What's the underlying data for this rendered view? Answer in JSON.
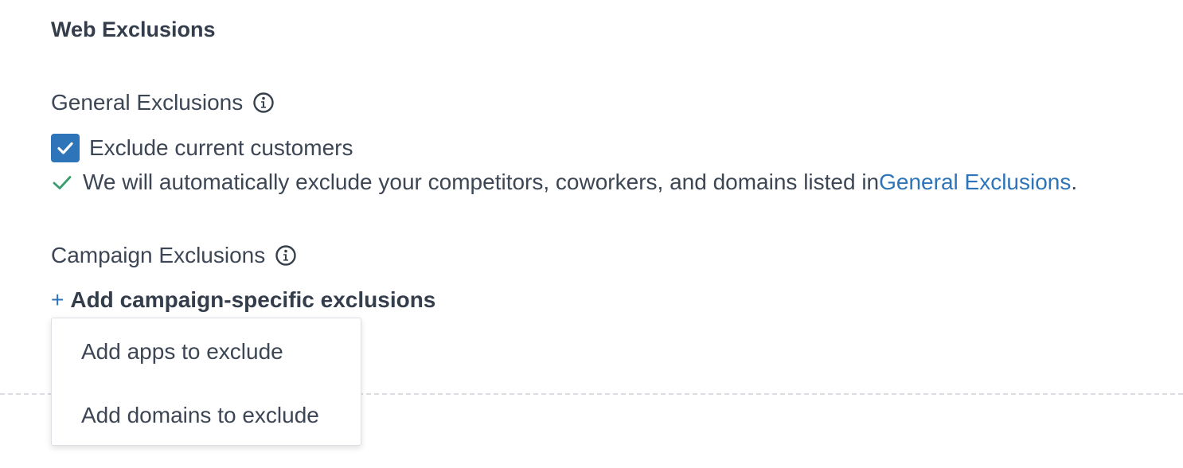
{
  "web_exclusions": {
    "title": "Web Exclusions"
  },
  "general_exclusions": {
    "heading": "General Exclusions",
    "info_icon": "info-circle-icon",
    "checkbox": {
      "label": "Exclude current customers",
      "checked": true
    },
    "note": {
      "text": "We will automatically exclude your competitors, coworkers, and domains listed in ",
      "link_text": "General Exclusions",
      "suffix": "."
    }
  },
  "campaign_exclusions": {
    "heading": "Campaign Exclusions",
    "info_icon": "info-circle-icon",
    "add_button": {
      "plus": "+",
      "label": "Add campaign-specific exclusions"
    },
    "dropdown": {
      "items": [
        {
          "label": "Add apps to exclude"
        },
        {
          "label": "Add domains to exclude"
        }
      ]
    }
  },
  "colors": {
    "accent": "#2e74b8",
    "success": "#3a9c6b",
    "text": "#3c4654",
    "divider": "#d9dde2"
  }
}
